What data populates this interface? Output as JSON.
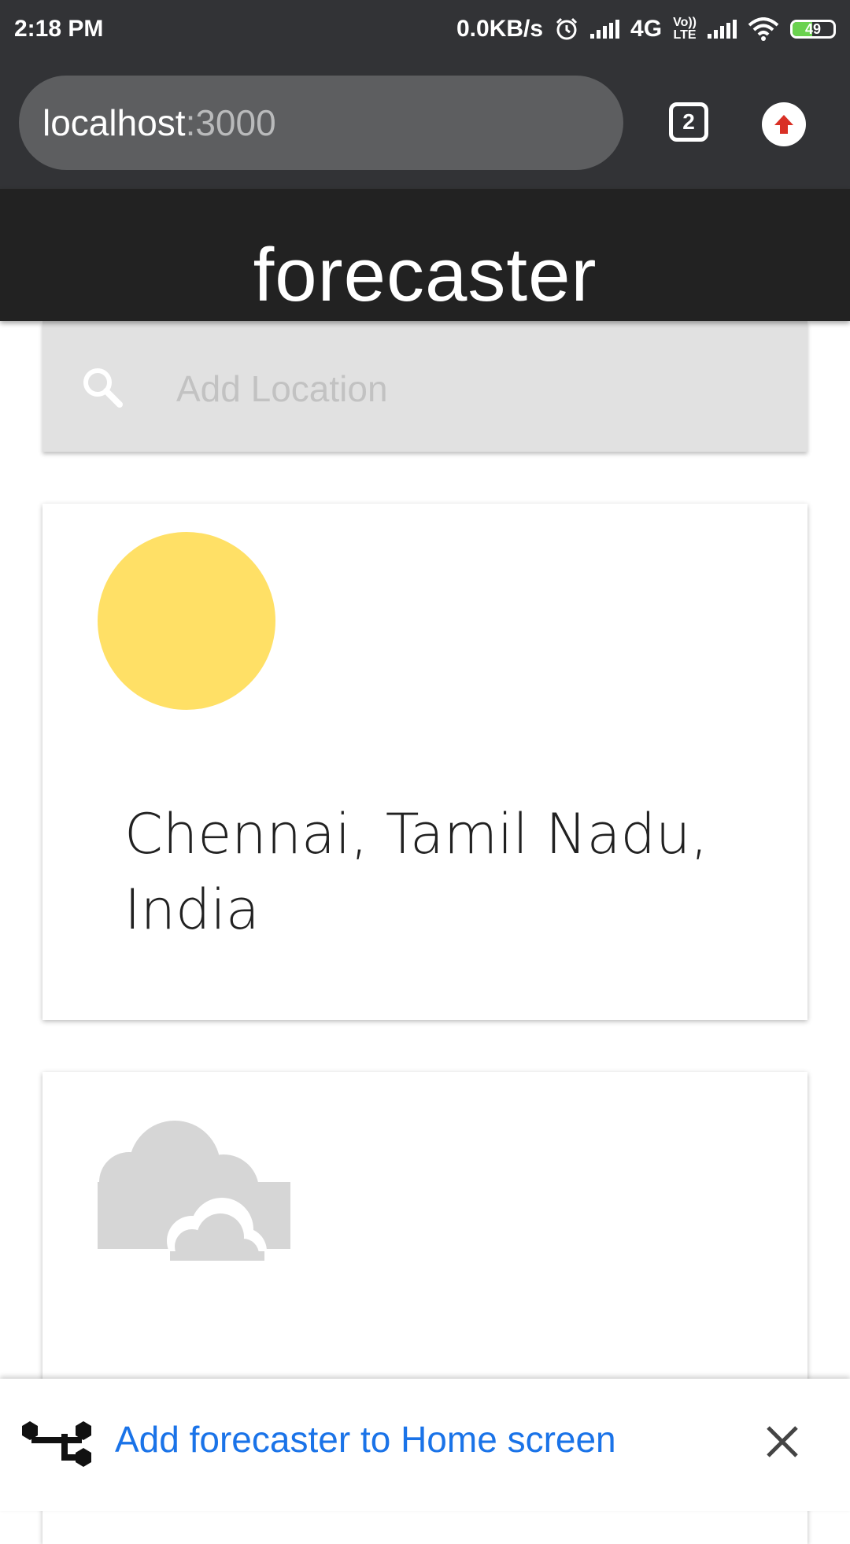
{
  "status_bar": {
    "time": "2:18 PM",
    "net_speed": "0.0KB/s",
    "network": "4G",
    "volte_top": "Vo))",
    "volte_bottom": "LTE",
    "battery": "49",
    "battery_level": 0.49,
    "battery_color": "#6ad24f"
  },
  "browser": {
    "url_host": "localhost",
    "url_port": ":3000",
    "tab_count": "2",
    "update_icon_color": "#d93025"
  },
  "app": {
    "title": "forecaster"
  },
  "search": {
    "placeholder": "Add Location"
  },
  "cards": [
    {
      "location": "Chennai, Tamil Nadu, India",
      "icon": "sun-icon",
      "icon_color": "#ffe066"
    },
    {
      "location": "",
      "icon": "cloud-icon",
      "icon_color": "#d6d6d6"
    }
  ],
  "a2hs_banner": {
    "text": "Add forecaster to Home screen",
    "link_color": "#1a73e8"
  }
}
